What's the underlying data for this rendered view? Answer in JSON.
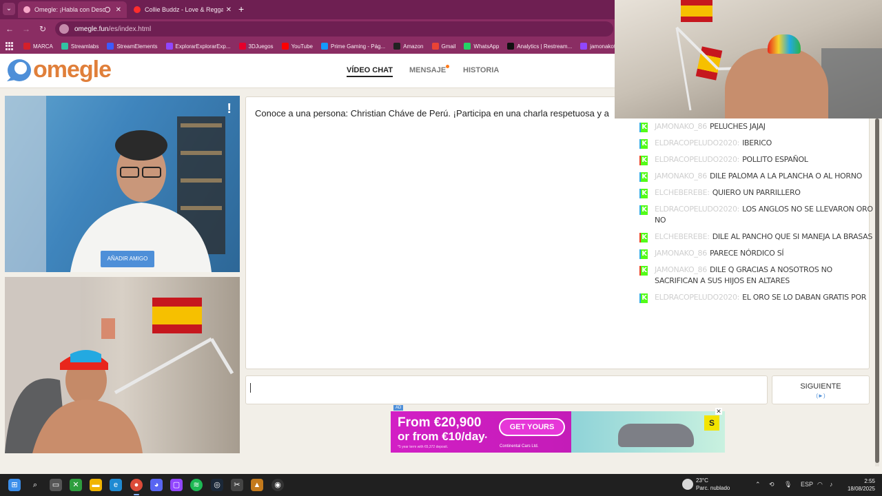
{
  "browser": {
    "tabs": [
      {
        "title": "Omegle: ¡Habla con Descon",
        "active": true
      },
      {
        "title": "Collie Buddz - Love & Reggae",
        "active": false
      }
    ],
    "new_tab": "+",
    "url_host": "omegle.fun",
    "url_path": "/es/index.html",
    "bookmarks": [
      {
        "label": "MARCA",
        "color": "#d4202a"
      },
      {
        "label": "Streamlabs",
        "color": "#31c3a2"
      },
      {
        "label": "StreamElements",
        "color": "#3d5afe"
      },
      {
        "label": "ExplorarExplorarExp...",
        "color": "#9146ff"
      },
      {
        "label": "3DJuegos",
        "color": "#e4002b"
      },
      {
        "label": "YouTube",
        "color": "#ff0000"
      },
      {
        "label": "Prime Gaming - Pág...",
        "color": "#1399ff"
      },
      {
        "label": "Amazon",
        "color": "#222222"
      },
      {
        "label": "Gmail",
        "color": "#ea4335"
      },
      {
        "label": "WhatsApp",
        "color": "#25d366"
      },
      {
        "label": "Analytics | Restream...",
        "color": "#111111"
      },
      {
        "label": "jamonakotv - T",
        "color": "#9146ff"
      }
    ]
  },
  "site": {
    "logo": "omegle",
    "nav": {
      "video_chat": "VÍDEO CHAT",
      "message": "MENSAJE",
      "history": "HISTORIA"
    }
  },
  "video": {
    "report_icon": "!",
    "add_friend": "AÑADIR AMIGO"
  },
  "chat": {
    "intro": "Conoce a una persona: Christian Cháve de Perú. ¡Participa en una charla respetuosa y a",
    "next_label": "SIGUIENTE",
    "next_hint": "(►)"
  },
  "ad": {
    "tag": "AD",
    "close": "✕",
    "line1": "From €20,900",
    "line2": "or from €10/day",
    "line2_mark": "*",
    "fine_print": "*5 year term with €6,372 deposit.",
    "cta": "GET YOURS",
    "brand": "Continental Cars Ltd."
  },
  "stream_chat": [
    {
      "user": "JAMONAKO_86",
      "text": "PELUCHES JAJAJ",
      "badge": "green"
    },
    {
      "user": "ELDRACOPELUDO2020:",
      "text": "IBERICO",
      "badge": "blue"
    },
    {
      "user": "ELDRACOPELUDO2020:",
      "text": "POLLITO ESPAÑOL",
      "badge": "orange"
    },
    {
      "user": "JAMONAKO_86",
      "text": "DILE PALOMA A LA PLANCHA O AL HORNO",
      "badge": "blue"
    },
    {
      "user": "ELCHEBEREBE:",
      "text": "QUIERO UN PARRILLERO",
      "badge": "blue"
    },
    {
      "user": "ELDRACOPELUDO2020:",
      "text": "LOS ANGLOS NO SE LLEVARON ORO NO",
      "badge": "blue"
    },
    {
      "user": "ELCHEBEREBE:",
      "text": "DILE AL PANCHO QUE SI MANEJA LA BRASAS",
      "badge": "orange"
    },
    {
      "user": "JAMONAKO_86",
      "text": "PARECE NÓRDICO SÍ",
      "badge": "blue"
    },
    {
      "user": "JAMONAKO_86",
      "text": "DILE Q GRACIAS A NOSOTROS NO SACRIFICAN A SUS HIJOS EN ALTARES",
      "badge": "orange"
    },
    {
      "user": "ELDRACOPELUDO2020:",
      "text": "EL ORO SE LO DABAN GRATIS POR AYUDARLES",
      "badge": "blue"
    }
  ],
  "taskbar": {
    "weather_temp": "23°C",
    "weather_desc": "Parc. nublado",
    "lang": "ESP",
    "time": "2:55",
    "date": "18/08/2025"
  }
}
